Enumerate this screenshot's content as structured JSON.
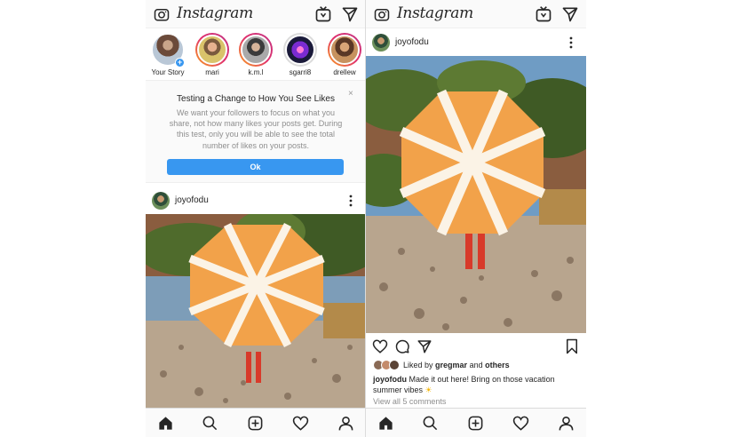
{
  "app": {
    "logo_text": "Instagram"
  },
  "icons": {
    "camera": "camera-icon",
    "igtv": "igtv-icon",
    "direct": "direct-message-icon",
    "more": "more-options-icon",
    "home": "home-icon",
    "search": "search-icon",
    "new_post": "new-post-icon",
    "activity": "heart-icon",
    "profile": "profile-icon",
    "like": "heart-icon",
    "comment": "comment-icon",
    "share": "share-icon",
    "save": "bookmark-icon"
  },
  "colors": {
    "accent": "#3897f0",
    "text": "#262626",
    "muted": "#8e8e8e",
    "story_ring": "#e1306c"
  },
  "left": {
    "stories": [
      {
        "name": "Your Story",
        "ring": "none"
      },
      {
        "name": "mari",
        "ring": "new"
      },
      {
        "name": "k.m.l",
        "ring": "new"
      },
      {
        "name": "sgarri8",
        "ring": "seen"
      },
      {
        "name": "drellew",
        "ring": "new"
      }
    ],
    "notice": {
      "title": "Testing a Change to How You See Likes",
      "body": "We want your followers to focus on what you share, not how many likes your posts get. During this test, only you will be able to see the total number of likes on your posts.",
      "close": "×",
      "button": "Ok"
    },
    "post": {
      "username": "joyofodu"
    }
  },
  "right": {
    "post": {
      "username": "joyofodu",
      "liked_by_prefix": "Liked by",
      "liked_by_user": "gregmar",
      "liked_by_joiner": "and",
      "liked_by_others": "others",
      "caption_user": "joyofodu",
      "caption_text": "Made it out here! Bring on those vacation summer vibes",
      "caption_emoji": "☀",
      "comments_link": "View all 5 comments"
    }
  }
}
